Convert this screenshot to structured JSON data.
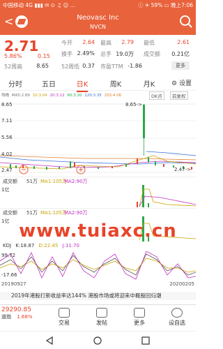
{
  "statusbar": {
    "carrier": "中国移动 4G ▮▮▮ ✉ ⊙ ♫ ☺ …",
    "time": "ⓘ ✈ 59% ▭ 晚上7:06"
  },
  "header": {
    "name": "Neovasc Inc",
    "code": "NVCN"
  },
  "quote": {
    "price": "2.71",
    "pct": "5.86%",
    "change": "0.15",
    "high52_label": "52周高",
    "high52_value": "8.65",
    "open_label": "今开",
    "open_value": "2.64",
    "high_label": "最高",
    "high_value": "2.79",
    "low_label": "最低",
    "low_value": "2.61",
    "turnover_label": "换手",
    "turnover_value": "2.49%",
    "total_label": "总手",
    "total_value": "19.0万",
    "amount_label": "成交额",
    "amount_value": "0.21亿",
    "low52_label": "52周低",
    "low52_value": "0.37",
    "pe_label": "市盈TTM",
    "pe_value": "-1.86",
    "more": "更多"
  },
  "tabs": [
    "分时",
    "五日",
    "日K",
    "周K",
    "月K"
  ],
  "settings_label": "设置",
  "ma": {
    "label": "均线",
    "ma5": "MA5:2.89",
    "ma10": "10:3.04",
    "ma20": "20:3.12",
    "ma60": "60:3.20",
    "ma120": "120:3.35",
    "ma250": "250:4.06"
  },
  "dk_label": "DK点",
  "fq_label": "前复权",
  "chart": {
    "y_top": "8.65",
    "y_mid1": "7.11",
    "y_mid2": "5.56",
    "y_mid3": "4.02",
    "y_bot": "2.47",
    "max_mark": "8.65->",
    "min_mark": "2.47->"
  },
  "vol1": {
    "label": "成交额",
    "value": "51万",
    "ma1": "MA1:105万",
    "ma2": "MA2:90万",
    "axis": "1亿"
  },
  "vol2": {
    "label": "成交额",
    "value": "51万",
    "ma1": "MA1:105万",
    "ma2": "MA2:90万",
    "axis": "1亿"
  },
  "watermark": "www.tuiaxc.cn",
  "kdj": {
    "label": "KDJ",
    "k": "K:18.87",
    "d": "D:22.45",
    "j": "J:11.70",
    "top": "99.72",
    "bot": "-17.66"
  },
  "dates": {
    "start": "20190927",
    "end": "20200205"
  },
  "news": "2019年港股打新收益率达144%  港股市场或将迎来中概股回归潮",
  "bottom": {
    "index_value": "29290.85",
    "index_label": "道指",
    "index_pct": "1.68%",
    "items": [
      "交易",
      "发帖",
      "更多",
      "设自选"
    ]
  },
  "colors": {
    "accent": "#e8623b",
    "up": "#e8442a",
    "down": "#2aa84a"
  }
}
